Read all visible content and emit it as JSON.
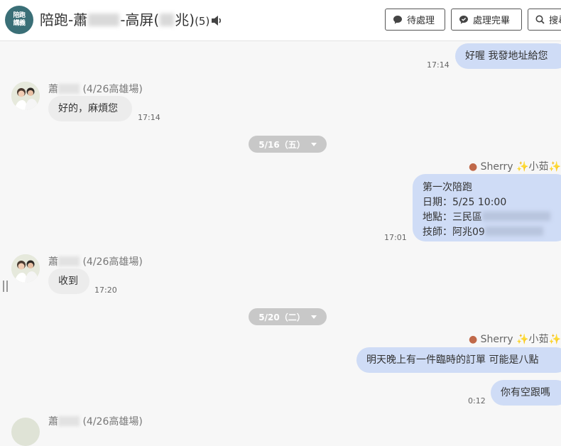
{
  "header": {
    "logo_line1": "陪跑",
    "logo_line2": "講義",
    "title_prefix": "陪跑-蕭",
    "title_mid": "-高屏(",
    "title_suffix": "兆)",
    "count": "(5)",
    "buttons": {
      "pending": "待處理",
      "done": "處理完畢",
      "search": "搜尋"
    }
  },
  "messages": {
    "m1": {
      "text": "好喔 我發地址給您",
      "time": "17:14"
    },
    "m2": {
      "sender": "蕭",
      "sender_tag": "(4/26高雄場)",
      "text": "好的，麻煩您",
      "time": "17:14"
    },
    "date1": "5/16（五）",
    "m3": {
      "agent": "Sherry ✨小茹✨",
      "line1": "第一次陪跑",
      "line2": "日期：5/25 10:00",
      "line3": "地點：三民區",
      "line4": "技師：阿兆09",
      "time": "17:01"
    },
    "m4": {
      "sender": "蕭",
      "sender_tag": "(4/26高雄場)",
      "text": "收到",
      "time": "17:20"
    },
    "date2": "5/20（二）",
    "m5": {
      "agent": "Sherry ✨小茹✨",
      "text": "明天晚上有一件臨時的訂單 可能是八點"
    },
    "m6": {
      "text": "你有空跟嗎",
      "time": "0:12"
    },
    "m7": {
      "sender": "蕭",
      "sender_tag": "(4/26高雄場)"
    }
  }
}
